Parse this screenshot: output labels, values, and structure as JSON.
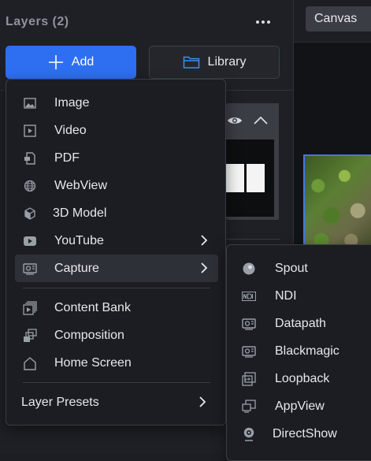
{
  "layers_panel": {
    "title": "Layers (2)",
    "add_label": "Add",
    "library_label": "Library"
  },
  "canvas": {
    "tab_label": "Canvas"
  },
  "add_menu": {
    "items": [
      {
        "label": "Image",
        "icon": "image-icon"
      },
      {
        "label": "Video",
        "icon": "video-icon"
      },
      {
        "label": "PDF",
        "icon": "pdf-icon"
      },
      {
        "label": "WebView",
        "icon": "globe-icon"
      },
      {
        "label": "3D Model",
        "icon": "cube-icon"
      },
      {
        "label": "YouTube",
        "icon": "youtube-icon",
        "submenu": true
      },
      {
        "label": "Capture",
        "icon": "capture-icon",
        "submenu": true,
        "active": true
      }
    ],
    "items2": [
      {
        "label": "Content Bank",
        "icon": "content-bank-icon"
      },
      {
        "label": "Composition",
        "icon": "composition-icon"
      },
      {
        "label": "Home Screen",
        "icon": "home-icon"
      }
    ],
    "presets_label": "Layer Presets"
  },
  "capture_menu": {
    "items": [
      {
        "label": "Spout",
        "icon": "spout-icon"
      },
      {
        "label": "NDI",
        "icon": "ndi-icon"
      },
      {
        "label": "Datapath",
        "icon": "capture-card-icon"
      },
      {
        "label": "Blackmagic",
        "icon": "capture-card-icon"
      },
      {
        "label": "Loopback",
        "icon": "loopback-icon"
      },
      {
        "label": "AppView",
        "icon": "app-window-icon"
      },
      {
        "label": "DirectShow",
        "icon": "webcam-icon"
      }
    ]
  },
  "colors": {
    "accent": "#2e6ff2",
    "selection": "#3a7bf0",
    "menu_bg": "#1b1d22",
    "panel_bg": "#1e2026"
  }
}
